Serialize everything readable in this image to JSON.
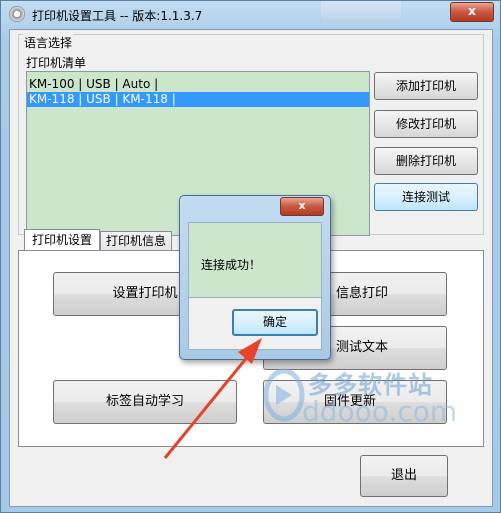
{
  "window": {
    "title": "打印机设置工具 -- 版本:1.1.3.7",
    "close_label": "x"
  },
  "language_group": {
    "title": "语言选择",
    "list_title": "打印机清单",
    "printers": [
      {
        "text": "KM-100 | USB | Auto |",
        "selected": false
      },
      {
        "text": "KM-118 | USB | KM-118 |",
        "selected": true
      }
    ]
  },
  "side_buttons": {
    "add": "添加打印机",
    "modify": "修改打印机",
    "delete": "删除打印机",
    "test": "连接测试"
  },
  "tabs": [
    {
      "label": "打印机设置",
      "active": true
    },
    {
      "label": "打印机信息",
      "active": false
    }
  ],
  "panel_buttons": {
    "setup": "设置打印机",
    "info_print": "信息打印",
    "test_text": "测试文本",
    "auto_learn": "标签自动学习",
    "firmware": "固件更新"
  },
  "exit_label": "退出",
  "dialog": {
    "close_label": "x",
    "message": "连接成功！",
    "ok_label": "确定"
  },
  "watermark": {
    "cn": "多多软件站",
    "en": "ddooo.com"
  },
  "colors": {
    "list_bg": "#cce6cc",
    "selection": "#3399ff",
    "arrow": "#e8422b",
    "title_bar": "#a9cbe8"
  }
}
